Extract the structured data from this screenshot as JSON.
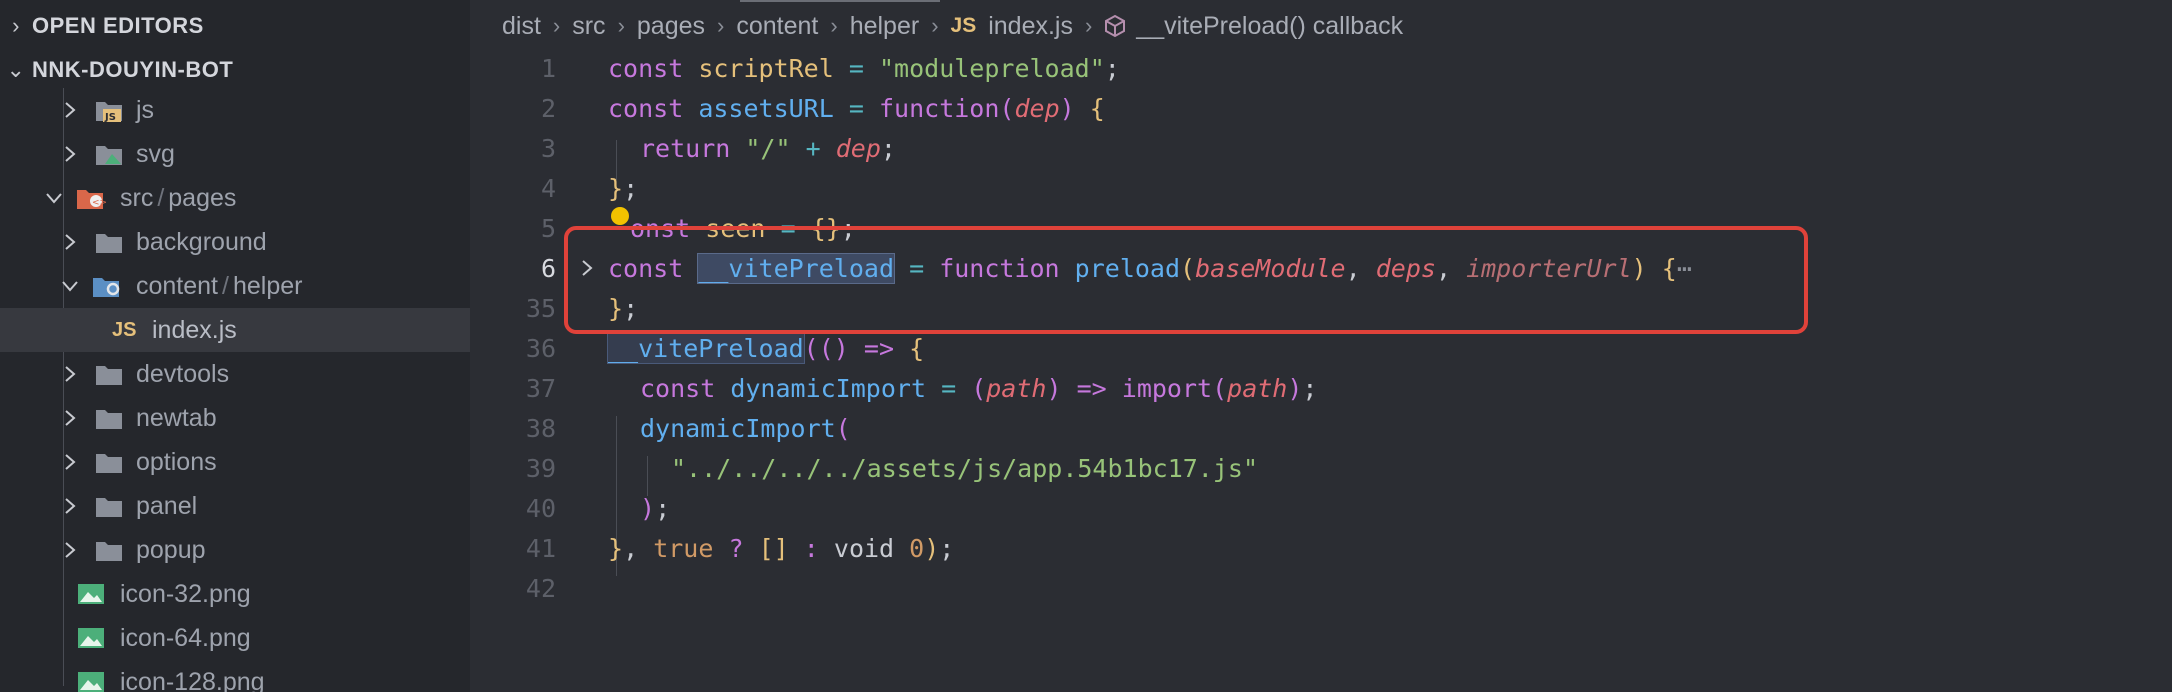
{
  "sidebar": {
    "open_editors": "OPEN EDITORS",
    "project": "NNK-DOUYIN-BOT",
    "items": [
      {
        "label": "js",
        "icon": "js-folder-icon",
        "expanded": false
      },
      {
        "label": "svg",
        "icon": "svg-folder-icon",
        "expanded": false
      },
      {
        "label_a": "src",
        "label_b": "pages",
        "icon": "src-folder-icon",
        "expanded": true
      },
      {
        "label": "background",
        "icon": "folder-icon",
        "expanded": false
      },
      {
        "label_a": "content",
        "label_b": "helper",
        "icon": "helper-folder-icon",
        "expanded": true
      },
      {
        "label": "index.js",
        "icon": "js-file-icon",
        "badge": "JS"
      },
      {
        "label": "devtools",
        "icon": "folder-icon",
        "expanded": false
      },
      {
        "label": "newtab",
        "icon": "folder-icon",
        "expanded": false
      },
      {
        "label": "options",
        "icon": "folder-icon",
        "expanded": false
      },
      {
        "label": "panel",
        "icon": "folder-icon",
        "expanded": false
      },
      {
        "label": "popup",
        "icon": "folder-icon",
        "expanded": false
      },
      {
        "label": "icon-32.png",
        "icon": "image-file-icon"
      },
      {
        "label": "icon-64.png",
        "icon": "image-file-icon"
      },
      {
        "label": "icon-128.png",
        "icon": "image-file-icon"
      }
    ]
  },
  "breadcrumb": {
    "parts": [
      "dist",
      "src",
      "pages",
      "content",
      "helper"
    ],
    "file_badge": "JS",
    "file": "index.js",
    "symbol": "__vitePreload() callback"
  },
  "code": {
    "line_numbers": [
      "1",
      "2",
      "3",
      "4",
      "5",
      "6",
      "35",
      "36",
      "37",
      "38",
      "39",
      "40",
      "41",
      "42"
    ],
    "l1": {
      "kw": "const",
      "name": "scriptRel",
      "eq": "=",
      "str": "\"modulepreload\"",
      "end": ";"
    },
    "l2": {
      "kw": "const",
      "name": "assetsURL",
      "eq": "=",
      "fn": "function",
      "open": "(",
      "param": "dep",
      "close": ")",
      "brace": "{"
    },
    "l3": {
      "kw": "return",
      "str": "\"/\"",
      "plus": "+",
      "param": "dep",
      "end": ";"
    },
    "l4": {
      "brace": "}",
      "end": ";"
    },
    "l5": {
      "kw": "onst",
      "name": "seen",
      "eq": "=",
      "val": "{}",
      "end": ";"
    },
    "l6": {
      "kw": "const",
      "name": "__vitePreload",
      "eq": "=",
      "fn": "function",
      "fname": "preload",
      "open": "(",
      "p1": "baseModule",
      "c1": ",",
      "p2": "deps",
      "c2": ",",
      "p3": "importerUrl",
      "close": ")",
      "brace": "{",
      "more": "⋯"
    },
    "l35": {
      "brace": "}",
      "end": ";"
    },
    "l36": {
      "name": "__vitePreload",
      "open": "((",
      "close": ")",
      "arrow": "=>",
      "brace": "{"
    },
    "l37": {
      "kw": "const",
      "name": "dynamicImport",
      "eq": "=",
      "open": "(",
      "param": "path",
      "close": ")",
      "arrow": "=>",
      "imp": "import",
      "open2": "(",
      "param2": "path",
      "close2": ")",
      "end": ";"
    },
    "l38": {
      "name": "dynamicImport",
      "open": "("
    },
    "l39": {
      "str": "\"../../../../assets/js/app.54b1bc17.js\""
    },
    "l40": {
      "close": ")",
      "end": ";"
    },
    "l41": {
      "brace": "}",
      "comma": ",",
      "tru": "true",
      "q": "?",
      "arr": "[]",
      "colon": ":",
      "vo": "void",
      "zero": "0",
      "close": ")",
      "end": ";"
    }
  },
  "colors": {
    "annotation": "#e0423a",
    "keyword": "#c678dd",
    "function": "#61afef",
    "string": "#98c379",
    "param": "#e06c75"
  }
}
